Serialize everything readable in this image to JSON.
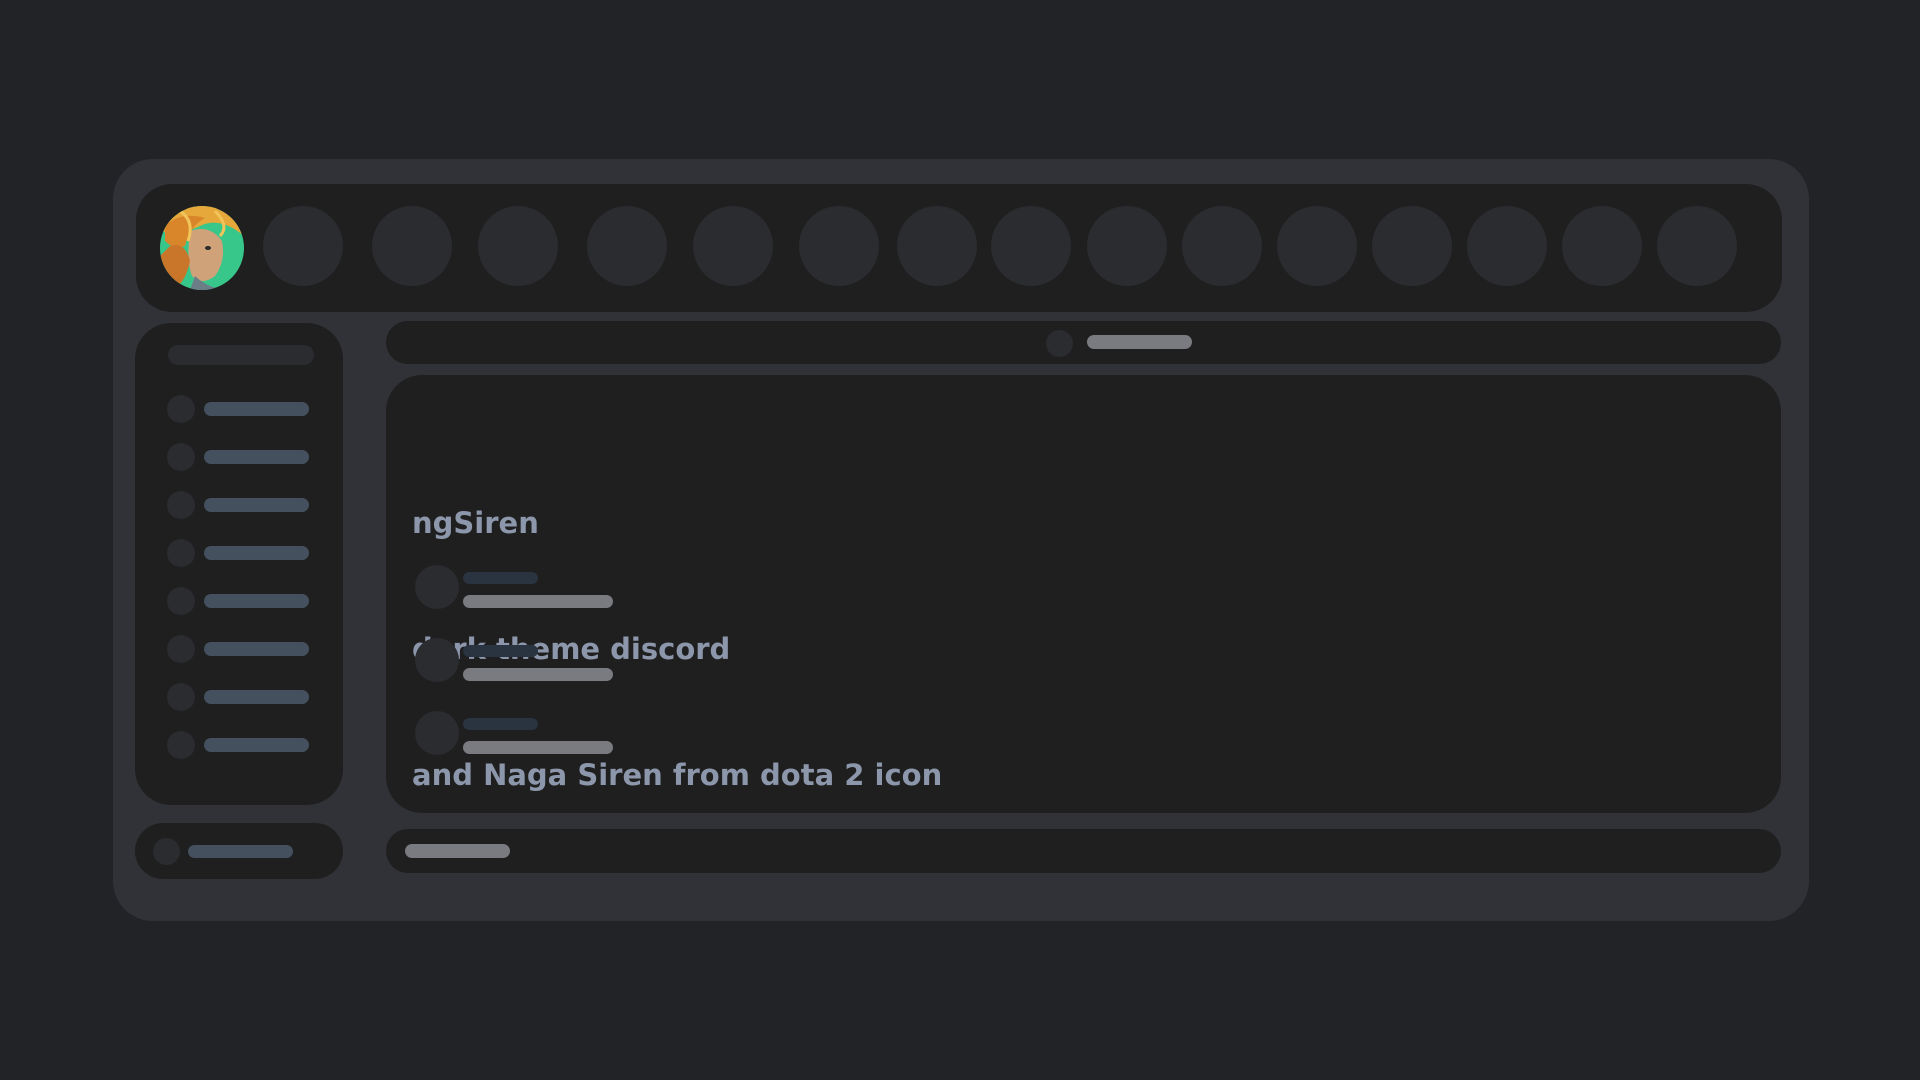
{
  "main": {
    "lines": [
      "ngSiren",
      "dark theme discord",
      "and Naga Siren from dota 2 icon"
    ]
  },
  "icons": {
    "profile": "naga-siren-avatar"
  },
  "colors": {
    "background": "#222327",
    "frame": "#313237",
    "panel": "#1f1f1f",
    "placeholder_circle": "#2b2c30",
    "channel_bar": "#45505e",
    "text_bar": "#7a7b80",
    "heading_text": "#8d97ab"
  }
}
